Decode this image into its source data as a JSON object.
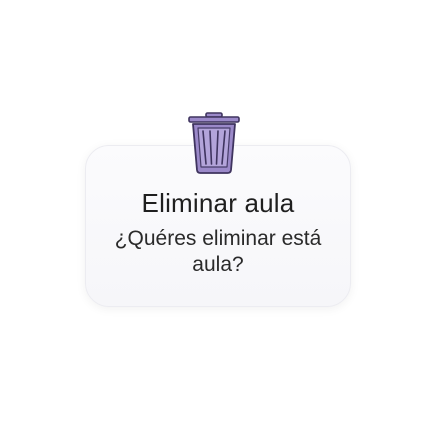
{
  "dialog": {
    "icon": "trash-icon",
    "accent_color": "#9b89c9",
    "icon_outline_color": "#3f345f",
    "title": "Eliminar aula",
    "message": "¿Quéres eliminar está aula?"
  }
}
